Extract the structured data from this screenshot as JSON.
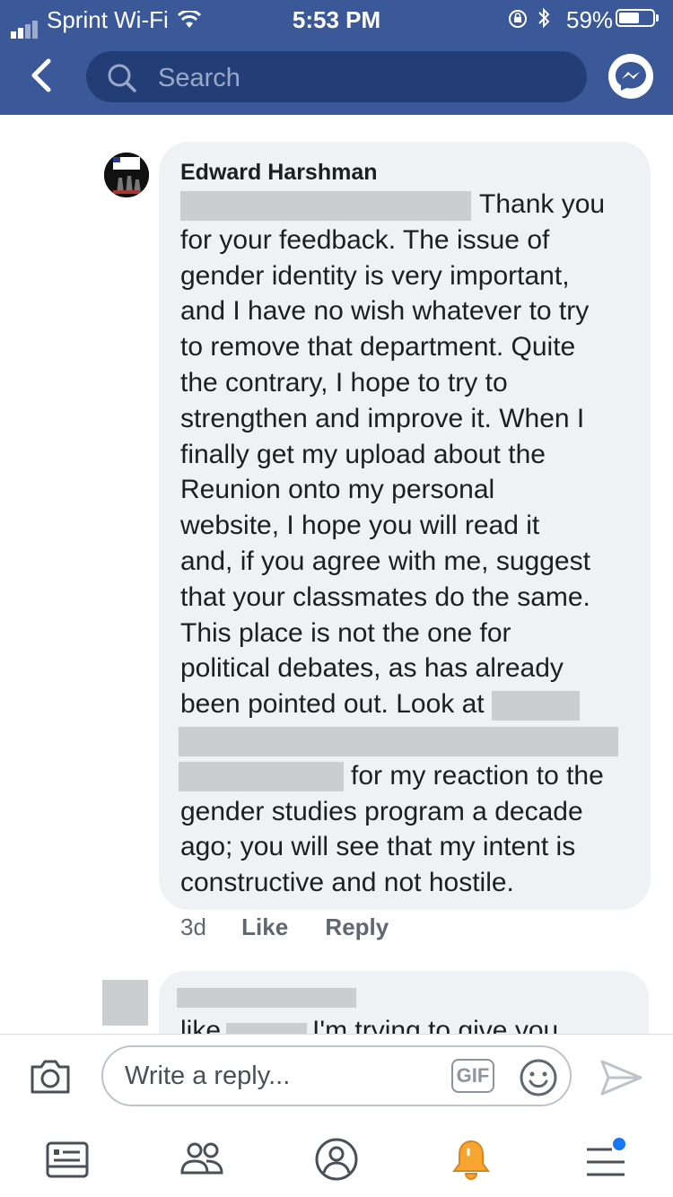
{
  "status_bar": {
    "carrier": "Sprint Wi-Fi",
    "time": "5:53 PM",
    "battery": "59%"
  },
  "header": {
    "search_placeholder": "Search"
  },
  "comment": {
    "author": "Edward Harshman",
    "lines": [
      "Thank you",
      "for your feedback. The issue of",
      "gender identity is very important,",
      "and I have no wish whatever to try",
      "to remove that department. Quite",
      "the contrary, I hope to try to",
      "strengthen and improve it. When I",
      "finally get my upload about the",
      "Reunion onto my personal",
      "website, I hope you will read it",
      "and, if you agree with me, suggest",
      "that your classmates do the same.",
      "This place is not the one for",
      "political debates, as has already",
      "been pointed out. Look at",
      "",
      "for my reaction to the",
      "gender studies program a decade",
      "ago; you will see that my intent is",
      "constructive and not hostile."
    ],
    "time": "3d",
    "like_label": "Like",
    "reply_label": "Reply"
  },
  "next_comment": {
    "text_start": "like",
    "text_end": "I'm trying to give you"
  },
  "reply_bar": {
    "placeholder": "Write a reply...",
    "gif_label": "GIF"
  },
  "tab_bar": {
    "icons": [
      "news-feed-icon",
      "friends-icon",
      "profile-icon",
      "notifications-icon",
      "menu-icon"
    ],
    "notification_color": "#f7a531",
    "dot_color": "#1877f2"
  }
}
